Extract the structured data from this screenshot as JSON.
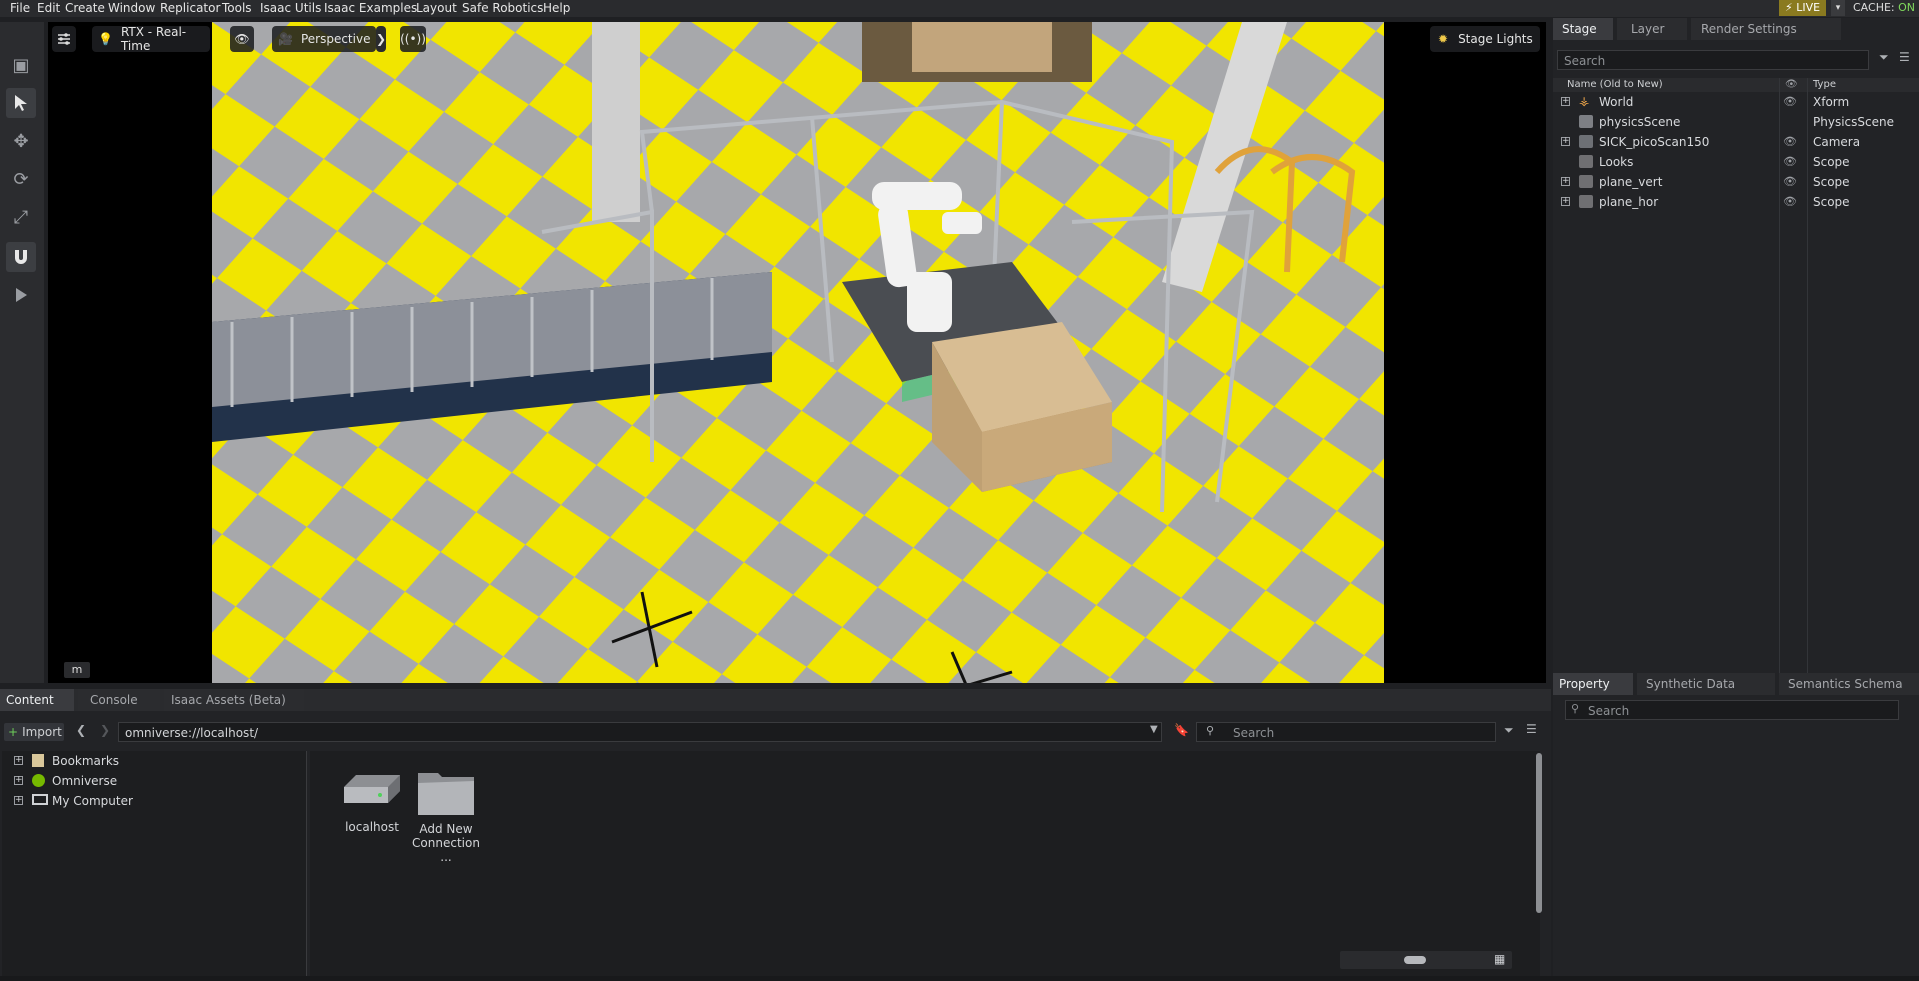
{
  "menubar": {
    "items": [
      "File",
      "Edit",
      "Create",
      "Window",
      "Replicator",
      "Tools",
      "Isaac Utils",
      "Isaac Examples",
      "Layout",
      "Safe Robotics",
      "Help"
    ],
    "live_label": "LIVE",
    "cache_label": "CACHE:",
    "cache_value": "ON"
  },
  "viewport": {
    "render_mode": "RTX - Real-Time",
    "camera": "Perspective",
    "lights": "Stage Lights",
    "hotkey": "m"
  },
  "stage": {
    "tabs": [
      "Stage",
      "Layer",
      "Render Settings"
    ],
    "search_placeholder": "Search",
    "col_name": "Name (Old to New)",
    "col_type": "Type",
    "prims": [
      {
        "name": "World",
        "type": "Xform"
      },
      {
        "name": "physicsScene",
        "type": "PhysicsScene"
      },
      {
        "name": "SICK_picoScan150",
        "type": "Camera"
      },
      {
        "name": "Looks",
        "type": "Scope"
      },
      {
        "name": "plane_vert",
        "type": "Scope"
      },
      {
        "name": "plane_hor",
        "type": "Scope"
      }
    ]
  },
  "property": {
    "tabs": [
      "Property",
      "Synthetic Data Recor...",
      "Semantics Schema E..."
    ],
    "search_placeholder": "Search"
  },
  "content": {
    "tabs": [
      "Content",
      "Console",
      "Isaac Assets (Beta)"
    ],
    "import_label": "Import",
    "path": "omniverse://localhost/",
    "search_placeholder": "Search",
    "tree": [
      "Bookmarks",
      "Omniverse",
      "My Computer"
    ],
    "tiles": [
      {
        "label": "localhost"
      },
      {
        "label": "Add New Connection ..."
      }
    ]
  },
  "colors": {
    "accent_live": "#8a7a20",
    "cache_on": "#7fd85c",
    "floor_yellow": "#f2e600",
    "floor_gray": "#a6a6a8"
  }
}
